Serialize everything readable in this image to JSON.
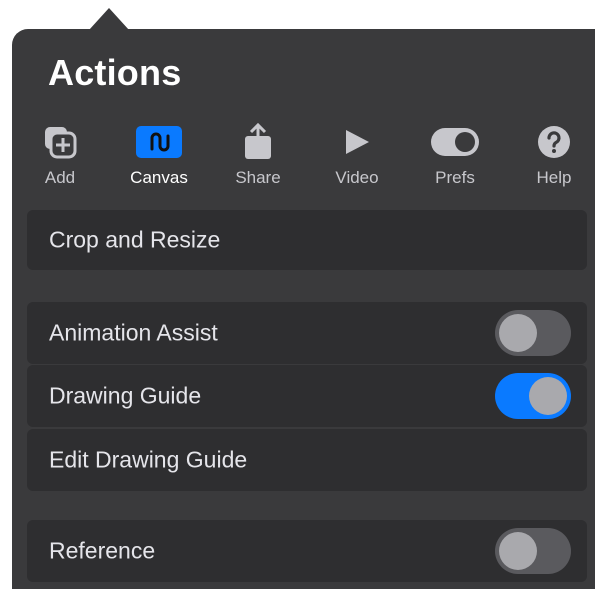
{
  "panel": {
    "title": "Actions"
  },
  "tabs": [
    {
      "label": "Add",
      "icon": "add-image-icon",
      "active": false
    },
    {
      "label": "Canvas",
      "icon": "canvas-icon",
      "active": true
    },
    {
      "label": "Share",
      "icon": "share-icon",
      "active": false
    },
    {
      "label": "Video",
      "icon": "play-icon",
      "active": false
    },
    {
      "label": "Prefs",
      "icon": "toggle-icon",
      "active": false
    },
    {
      "label": "Help",
      "icon": "help-icon",
      "active": false
    }
  ],
  "rows": {
    "crop_resize": {
      "label": "Crop and Resize"
    },
    "animation_assist": {
      "label": "Animation Assist",
      "toggle": "off"
    },
    "drawing_guide": {
      "label": "Drawing Guide",
      "toggle": "on"
    },
    "edit_drawing_guide": {
      "label": "Edit Drawing Guide"
    },
    "reference": {
      "label": "Reference",
      "toggle": "off"
    }
  },
  "colors": {
    "panel_bg": "#3a3a3c",
    "row_bg": "#2e2e30",
    "accent_blue": "#0a7aff",
    "toggle_off": "#5a5a5e"
  }
}
